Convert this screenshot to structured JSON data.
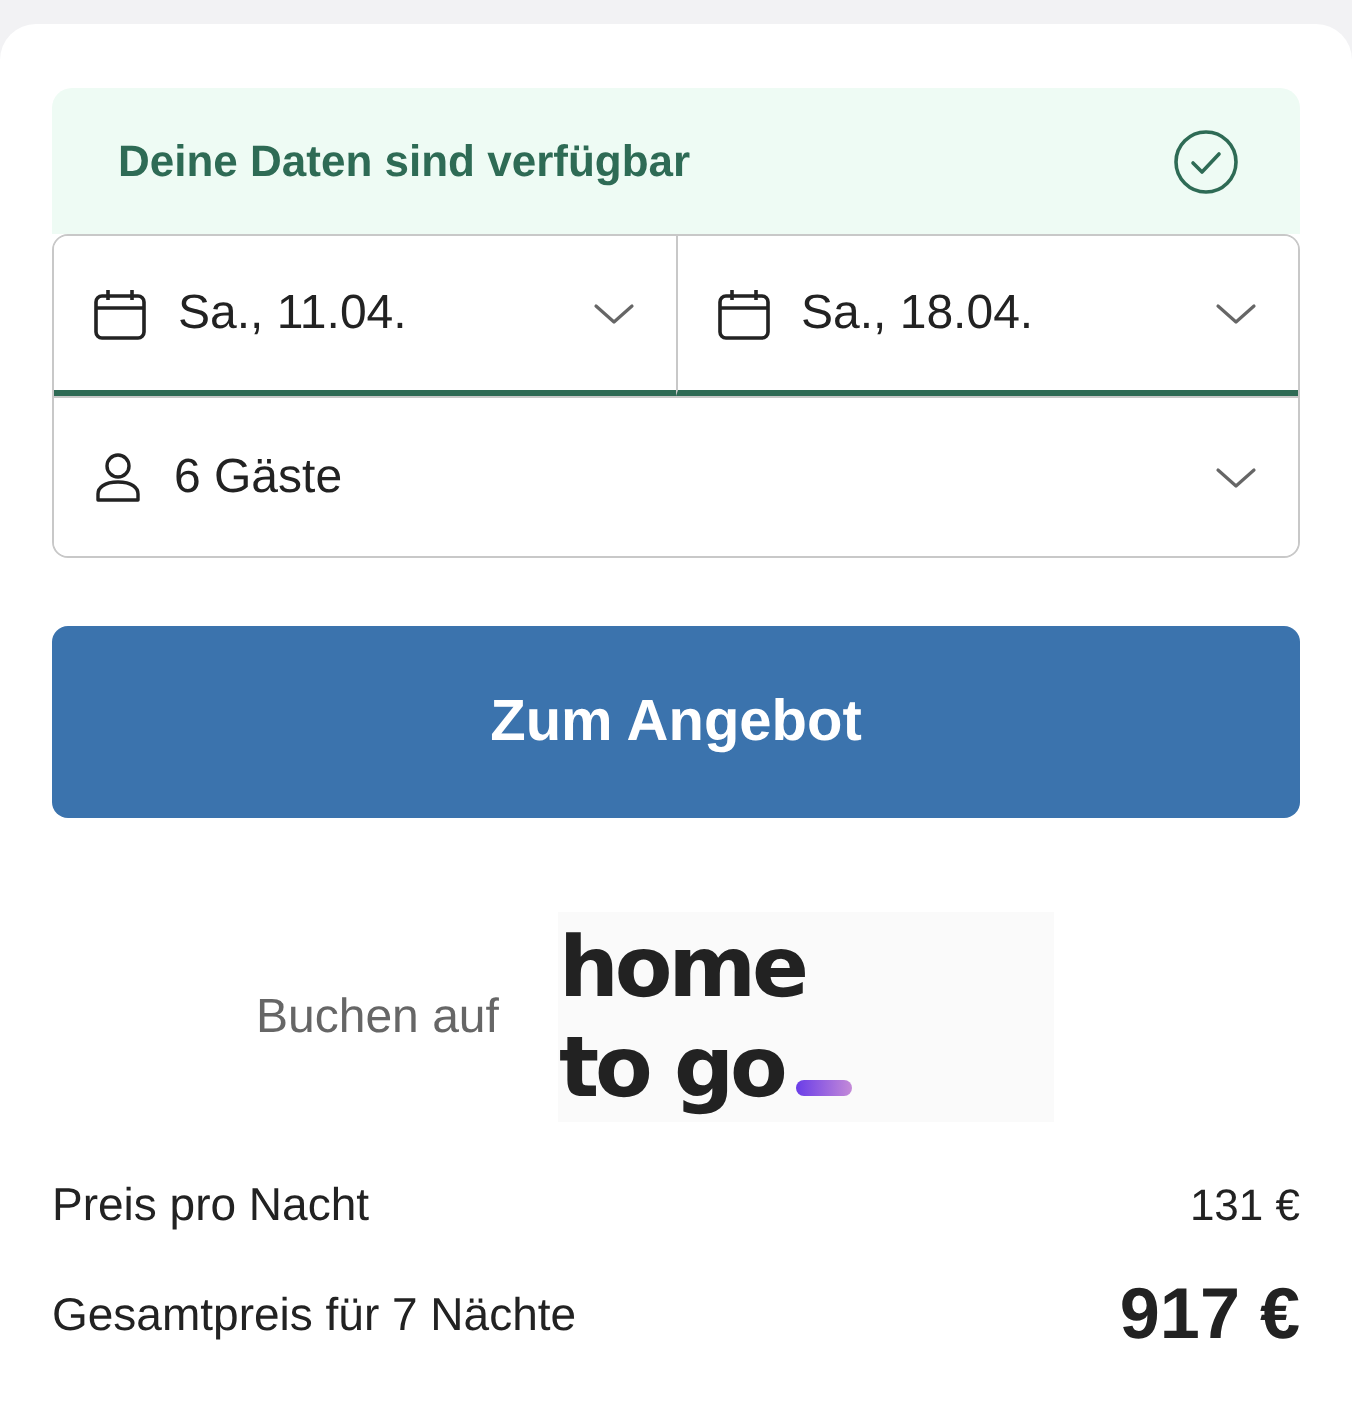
{
  "availability": {
    "available": true,
    "message": "Deine Daten sind verfügbar"
  },
  "dates": [
    {
      "label": "Sa., 11.04."
    },
    {
      "label": "Sa., 18.04."
    }
  ],
  "guests": {
    "label": "6 Gäste"
  },
  "cta_button": "Zum Angebot",
  "booking": {
    "label": "Buchen auf",
    "logo_lines": [
      "home",
      "to go"
    ]
  },
  "prices": [
    {
      "label": "Preis pro Nacht",
      "value": "131 €",
      "kind": "regular"
    },
    {
      "label": "Gesamtpreis für 7 Nächte",
      "value": "917 €",
      "kind": "total"
    }
  ]
}
